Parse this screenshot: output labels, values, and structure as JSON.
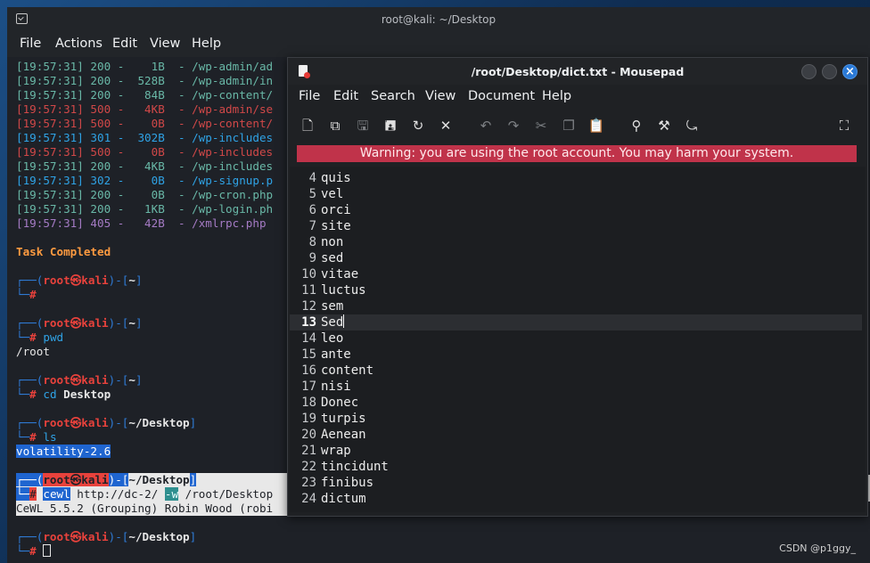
{
  "terminal": {
    "title": "root@kali: ~/Desktop",
    "menu": [
      "File",
      "Actions",
      "Edit",
      "View",
      "Help"
    ],
    "log": [
      {
        "time": "[19:57:31]",
        "code": "200",
        "size": "   1B",
        "path": "/wp-admin/ad",
        "color": "green"
      },
      {
        "time": "[19:57:31]",
        "code": "200",
        "size": " 528B",
        "path": "/wp-admin/in",
        "color": "green"
      },
      {
        "time": "[19:57:31]",
        "code": "200",
        "size": "  84B",
        "path": "/wp-content/",
        "color": "green"
      },
      {
        "time": "[19:57:31]",
        "code": "500",
        "size": "  4KB",
        "path": "/wp-admin/se",
        "color": "red"
      },
      {
        "time": "[19:57:31]",
        "code": "500",
        "size": "   0B",
        "path": "/wp-content/",
        "color": "red"
      },
      {
        "time": "[19:57:31]",
        "code": "301",
        "size": " 302B",
        "path": "/wp-includes",
        "color": "blue"
      },
      {
        "time": "[19:57:31]",
        "code": "500",
        "size": "   0B",
        "path": "/wp-includes",
        "color": "red"
      },
      {
        "time": "[19:57:31]",
        "code": "200",
        "size": "  4KB",
        "path": "/wp-includes",
        "color": "green"
      },
      {
        "time": "[19:57:31]",
        "code": "302",
        "size": "   0B",
        "path": "/wp-signup.p",
        "color": "blue"
      },
      {
        "time": "[19:57:31]",
        "code": "200",
        "size": "   0B",
        "path": "/wp-cron.php",
        "color": "green"
      },
      {
        "time": "[19:57:31]",
        "code": "200",
        "size": "  1KB",
        "path": "/wp-login.ph",
        "color": "green"
      },
      {
        "time": "[19:57:31]",
        "code": "405",
        "size": "  42B",
        "path": "/xmlrpc.php",
        "color": "purple"
      }
    ],
    "task_completed": "Task Completed",
    "prompt_user": "root",
    "prompt_host": "kali",
    "prompt_at": "㉿",
    "dir_home": "~",
    "dir_desktop": "~/Desktop",
    "cmd_pwd": "pwd",
    "out_pwd": "/root",
    "cmd_cd": "cd",
    "cmd_cd_arg": "Desktop",
    "cmd_ls": "ls",
    "out_ls": "volatility-2.6",
    "cmd_cewl": "cewl",
    "cmd_cewl_url": " http://dc-2/ ",
    "cmd_cewl_flag": "-w",
    "cmd_cewl_path": " /root/Desktop",
    "out_cewl": "CeWL 5.5.2 (Grouping) Robin Wood (robi"
  },
  "mousepad": {
    "title": "/root/Desktop/dict.txt - Mousepad",
    "menu": [
      "File",
      "Edit",
      "Search",
      "View",
      "Document",
      "Help"
    ],
    "toolbar_icons": [
      "new-document-icon",
      "new-window-icon",
      "save-icon",
      "save-as-icon",
      "reload-icon",
      "close-icon",
      "undo-icon",
      "redo-icon",
      "cut-icon",
      "copy-icon",
      "paste-icon",
      "find-icon",
      "find-replace-icon",
      "go-to-line-icon",
      "fullscreen-icon"
    ],
    "warning": "Warning: you are using the root account. You may harm your system.",
    "current_line": "13",
    "lines": [
      {
        "n": "4",
        "t": "quis"
      },
      {
        "n": "5",
        "t": "vel"
      },
      {
        "n": "6",
        "t": "orci"
      },
      {
        "n": "7",
        "t": "site"
      },
      {
        "n": "8",
        "t": "non"
      },
      {
        "n": "9",
        "t": "sed"
      },
      {
        "n": "10",
        "t": "vitae"
      },
      {
        "n": "11",
        "t": "luctus"
      },
      {
        "n": "12",
        "t": "sem"
      },
      {
        "n": "13",
        "t": "Sed"
      },
      {
        "n": "14",
        "t": "leo"
      },
      {
        "n": "15",
        "t": "ante"
      },
      {
        "n": "16",
        "t": "content"
      },
      {
        "n": "17",
        "t": "nisi"
      },
      {
        "n": "18",
        "t": "Donec"
      },
      {
        "n": "19",
        "t": "turpis"
      },
      {
        "n": "20",
        "t": "Aenean"
      },
      {
        "n": "21",
        "t": "wrap"
      },
      {
        "n": "22",
        "t": "tincidunt"
      },
      {
        "n": "23",
        "t": "finibus"
      },
      {
        "n": "24",
        "t": "dictum"
      }
    ]
  },
  "watermark": "CSDN @p1ggy_"
}
